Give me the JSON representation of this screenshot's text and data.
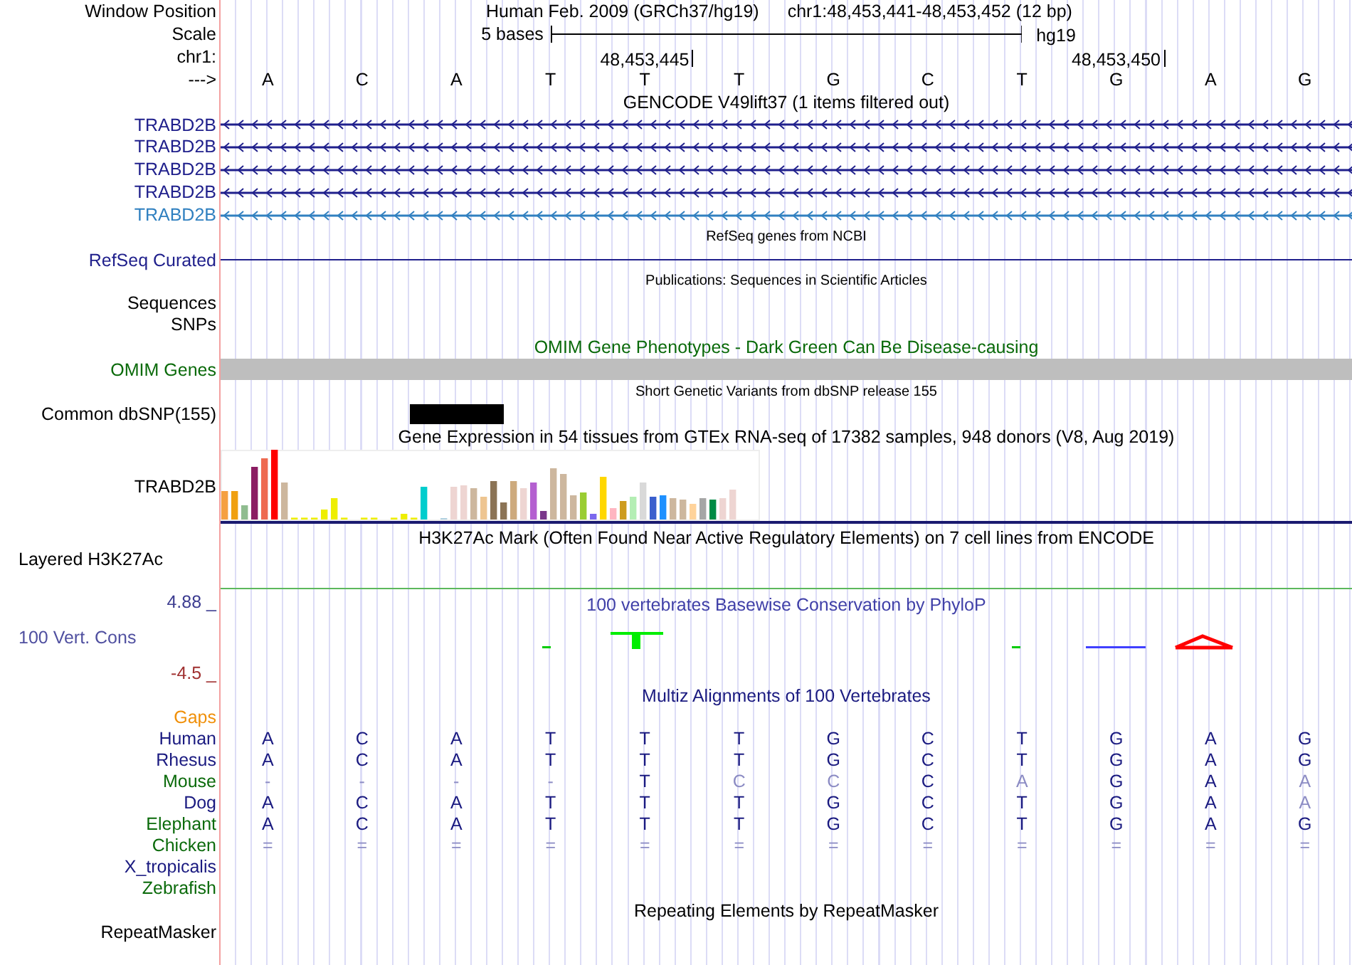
{
  "header": {
    "window_position_label": "Window Position",
    "assembly": "Human Feb. 2009 (GRCh37/hg19)",
    "position": "chr1:48,453,441-48,453,452 (12 bp)",
    "scale_label": "Scale",
    "scale_text": "5 bases",
    "scale_db": "hg19",
    "chrom_label": "chr1:",
    "ticks": [
      "48,453,445",
      "48,453,450"
    ],
    "strand_label": "--->",
    "bases": [
      "A",
      "C",
      "A",
      "T",
      "T",
      "T",
      "G",
      "C",
      "T",
      "G",
      "A",
      "G"
    ]
  },
  "tracks": [
    {
      "kind": "gene_group",
      "title": "GENCODE V49lift37 (1 items filtered out)",
      "items": [
        {
          "label": "TRABD2B",
          "color": "#20208c"
        },
        {
          "label": "TRABD2B",
          "color": "#20208c"
        },
        {
          "label": "TRABD2B",
          "color": "#20208c"
        },
        {
          "label": "TRABD2B",
          "color": "#20208c"
        },
        {
          "label": "TRABD2B",
          "color": "#3080c0"
        }
      ]
    },
    {
      "kind": "refseq",
      "title": "RefSeq genes from NCBI",
      "label": "RefSeq Curated"
    },
    {
      "kind": "labels",
      "title": "Publications: Sequences in Scientific Articles",
      "labels": [
        "Sequences",
        "SNPs"
      ]
    },
    {
      "kind": "omim",
      "title": "OMIM Gene Phenotypes - Dark Green Can Be Disease-causing",
      "label": "OMIM Genes"
    },
    {
      "kind": "dbsnp",
      "title": "Short Genetic Variants from dbSNP release 155",
      "label": "Common dbSNP(155)"
    },
    {
      "kind": "gtex",
      "title": "Gene Expression in 54 tissues from GTEx RNA-seq of 17382 samples, 948 donors (V8, Aug 2019)",
      "label": "TRABD2B"
    },
    {
      "kind": "h3k27ac",
      "title": "H3K27Ac Mark (Often Found Near Active Regulatory Elements) on 7 cell lines from ENCODE",
      "label": "Layered H3K27Ac"
    },
    {
      "kind": "conservation",
      "title": "100 vertebrates Basewise Conservation by PhyloP",
      "label": "100 Vert. Cons",
      "y_max": "4.88 _",
      "y_min": "-4.5 _"
    },
    {
      "kind": "multiz",
      "title": "Multiz Alignments of 100 Vertebrates",
      "gaps_label": "Gaps",
      "species": [
        {
          "name": "Human",
          "color": "#1a1a80",
          "cells": [
            {
              "text": "A",
              "faded": false
            },
            {
              "text": "C",
              "faded": false
            },
            {
              "text": "A",
              "faded": false
            },
            {
              "text": "T",
              "faded": false
            },
            {
              "text": "T",
              "faded": false
            },
            {
              "text": "T",
              "faded": false
            },
            {
              "text": "G",
              "faded": false
            },
            {
              "text": "C",
              "faded": false
            },
            {
              "text": "T",
              "faded": false
            },
            {
              "text": "G",
              "faded": false
            },
            {
              "text": "A",
              "faded": false
            },
            {
              "text": "G",
              "faded": false
            }
          ]
        },
        {
          "name": "Rhesus",
          "color": "#1a1a80",
          "cells": [
            {
              "text": "A",
              "faded": false
            },
            {
              "text": "C",
              "faded": false
            },
            {
              "text": "A",
              "faded": false
            },
            {
              "text": "T",
              "faded": false
            },
            {
              "text": "T",
              "faded": false
            },
            {
              "text": "T",
              "faded": false
            },
            {
              "text": "G",
              "faded": false
            },
            {
              "text": "C",
              "faded": false
            },
            {
              "text": "T",
              "faded": false
            },
            {
              "text": "G",
              "faded": false
            },
            {
              "text": "A",
              "faded": false
            },
            {
              "text": "G",
              "faded": false
            }
          ]
        },
        {
          "name": "Mouse",
          "color": "#0a6a0a",
          "cells": [
            {
              "text": "-",
              "faded": true
            },
            {
              "text": "-",
              "faded": true
            },
            {
              "text": "-",
              "faded": true
            },
            {
              "text": "-",
              "faded": true
            },
            {
              "text": "T",
              "faded": false
            },
            {
              "text": "C",
              "faded": true
            },
            {
              "text": "C",
              "faded": true
            },
            {
              "text": "C",
              "faded": false
            },
            {
              "text": "A",
              "faded": true
            },
            {
              "text": "G",
              "faded": false
            },
            {
              "text": "A",
              "faded": false
            },
            {
              "text": "A",
              "faded": true
            }
          ]
        },
        {
          "name": "Dog",
          "color": "#1a1a80",
          "cells": [
            {
              "text": "A",
              "faded": false
            },
            {
              "text": "C",
              "faded": false
            },
            {
              "text": "A",
              "faded": false
            },
            {
              "text": "T",
              "faded": false
            },
            {
              "text": "T",
              "faded": false
            },
            {
              "text": "T",
              "faded": false
            },
            {
              "text": "G",
              "faded": false
            },
            {
              "text": "C",
              "faded": false
            },
            {
              "text": "T",
              "faded": false
            },
            {
              "text": "G",
              "faded": false
            },
            {
              "text": "A",
              "faded": false
            },
            {
              "text": "A",
              "faded": true
            }
          ]
        },
        {
          "name": "Elephant",
          "color": "#0a6a0a",
          "cells": [
            {
              "text": "A",
              "faded": false
            },
            {
              "text": "C",
              "faded": false
            },
            {
              "text": "A",
              "faded": false
            },
            {
              "text": "T",
              "faded": false
            },
            {
              "text": "T",
              "faded": false
            },
            {
              "text": "T",
              "faded": false
            },
            {
              "text": "G",
              "faded": false
            },
            {
              "text": "C",
              "faded": false
            },
            {
              "text": "T",
              "faded": false
            },
            {
              "text": "G",
              "faded": false
            },
            {
              "text": "A",
              "faded": false
            },
            {
              "text": "G",
              "faded": false
            }
          ]
        },
        {
          "name": "Chicken",
          "color": "#0a6a0a",
          "cells": [
            {
              "text": "=",
              "faded": true
            },
            {
              "text": "=",
              "faded": true
            },
            {
              "text": "=",
              "faded": true
            },
            {
              "text": "=",
              "faded": true
            },
            {
              "text": "=",
              "faded": true
            },
            {
              "text": "=",
              "faded": true
            },
            {
              "text": "=",
              "faded": true
            },
            {
              "text": "=",
              "faded": true
            },
            {
              "text": "=",
              "faded": true
            },
            {
              "text": "=",
              "faded": true
            },
            {
              "text": "=",
              "faded": true
            },
            {
              "text": "=",
              "faded": true
            }
          ]
        },
        {
          "name": "X_tropicalis",
          "color": "#1a1a80"
        },
        {
          "name": "Zebrafish",
          "color": "#0a6a0a"
        }
      ]
    },
    {
      "kind": "repeatmasker",
      "title": "Repeating Elements by RepeatMasker",
      "label": "RepeatMasker"
    }
  ]
}
